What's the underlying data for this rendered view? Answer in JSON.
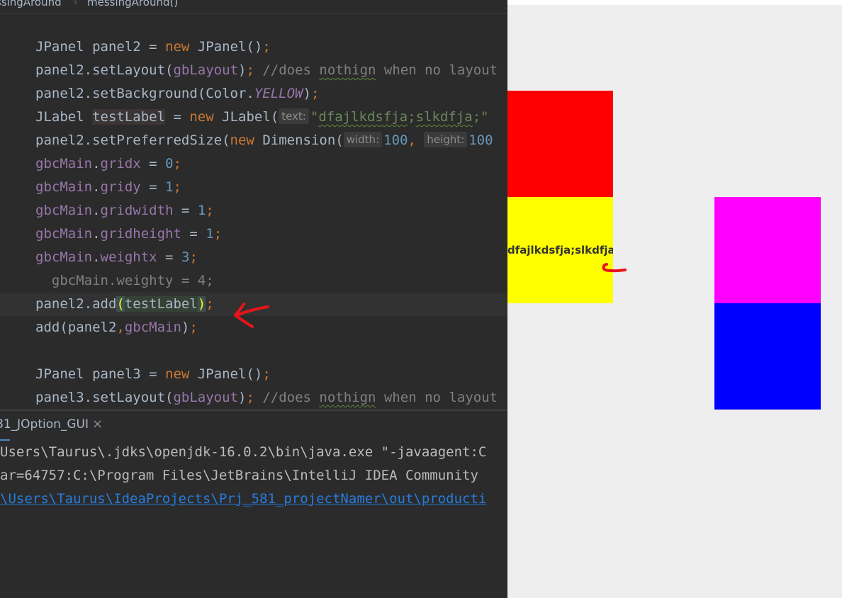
{
  "breadcrumb": {
    "left": "ssingAround",
    "separator": "›",
    "right": "messingAround()"
  },
  "code": {
    "lines": [
      {
        "t1": "JPanel panel2 = ",
        "t2": "new",
        "t3": " JPanel()",
        "t4": ";"
      },
      {
        "t1": "panel2.setLayout(",
        "t2": "gbLayout",
        "t3": ")",
        "t4": "; ",
        "c1": "//does ",
        "c2": "nothign",
        "c3": " when no layout"
      },
      {
        "t1": "panel2.setBackground(Color.",
        "t2": "YELLOW",
        "t3": ")",
        "t4": ";"
      },
      {
        "t1": "JLabel ",
        "t2": "testLabel",
        "t3": " = ",
        "t4": "new",
        "t5": " JLabel(",
        "hint": "text:",
        "s1": "\"",
        "s2": "dfajlkdsfja",
        "s3": ";",
        "s4": "slkdfja",
        "s5": ";\""
      },
      {
        "t1": "panel2.setPreferredSize(",
        "t2": "new",
        "t3": " Dimension(",
        "hint1": "width:",
        "n1": "100",
        "t4": ", ",
        "hint2": "height:",
        "n2": "100"
      },
      {
        "f": "gbcMain",
        "t1": ".",
        "f2": "gridx",
        "t2": " = ",
        "n": "0",
        "t3": ";"
      },
      {
        "f": "gbcMain",
        "t1": ".",
        "f2": "gridy",
        "t2": " = ",
        "n": "1",
        "t3": ";"
      },
      {
        "f": "gbcMain",
        "t1": ".",
        "f2": "gridwidth",
        "t2": " = ",
        "n": "1",
        "t3": ";"
      },
      {
        "f": "gbcMain",
        "t1": ".",
        "f2": "gridheight",
        "t2": " = ",
        "n": "1",
        "t3": ";"
      },
      {
        "f": "gbcMain",
        "t1": ".",
        "f2": "weightx",
        "t2": " = ",
        "n": "3",
        "t3": ";"
      },
      {
        "c": "  gbcMain.weighty = 4;"
      },
      {
        "t1": "panel2.add",
        "b1": "(",
        "a": "testLabel",
        "b2": ")",
        "t2": ";"
      },
      {
        "t1": "add(panel2",
        "t2": ",",
        "f": "gbcMain",
        "t3": ")",
        "t4": ";"
      },
      {
        "t1": ""
      },
      {
        "t1": "JPanel panel3 = ",
        "t2": "new",
        "t3": " JPanel()",
        "t4": ";"
      },
      {
        "t1": "panel3.setLayout(",
        "t2": "gbLayout",
        "t3": ")",
        "t4": "; ",
        "c1": "//does ",
        "c2": "nothign",
        "c3": " when no layout"
      }
    ]
  },
  "run_panel": {
    "tab_label": "81_JOption_GUI",
    "close_icon": "×",
    "console_lines": [
      "Users\\Taurus\\.jdks\\openjdk-16.0.2\\bin\\java.exe \"-javaagent:C",
      "ar=64757:C:\\Program Files\\JetBrains\\IntelliJ IDEA Community",
      "\\Users\\Taurus\\IdeaProjects\\Prj_581_projectNamer\\out\\producti"
    ]
  },
  "app_window": {
    "label_text": "dfajlkdsfja;slkdfja",
    "colors": {
      "panel1": "#ff0000",
      "panel2": "#ffff00",
      "panel3": "#ff00ff",
      "panel4": "#0000ff",
      "background": "#eeeeee",
      "annotation": "#e8141a"
    }
  }
}
